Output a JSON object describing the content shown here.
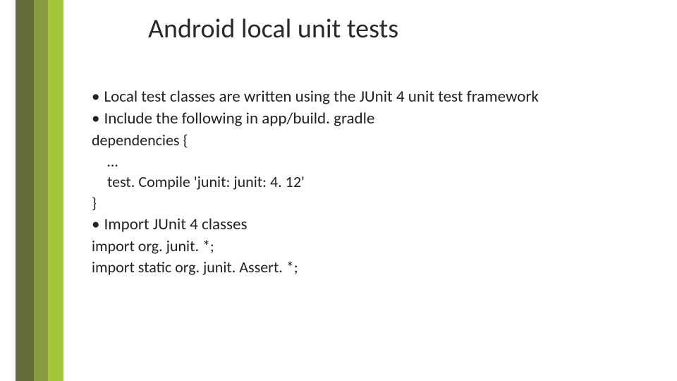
{
  "title": "Android local unit tests",
  "bullets": {
    "b1": "Local test classes are written using the JUnit 4 unit test framework",
    "b2": "Include the following in app/build. gradle",
    "b3": "Import JUnit 4 classes"
  },
  "code": {
    "dep_open": "dependencies {",
    "ellipsis": "…",
    "testcompile": "test. Compile 'junit: junit: 4. 12'",
    "dep_close": "}",
    "import1": "import org. junit. *;",
    "import2": "import static org. junit. Assert. *;"
  }
}
